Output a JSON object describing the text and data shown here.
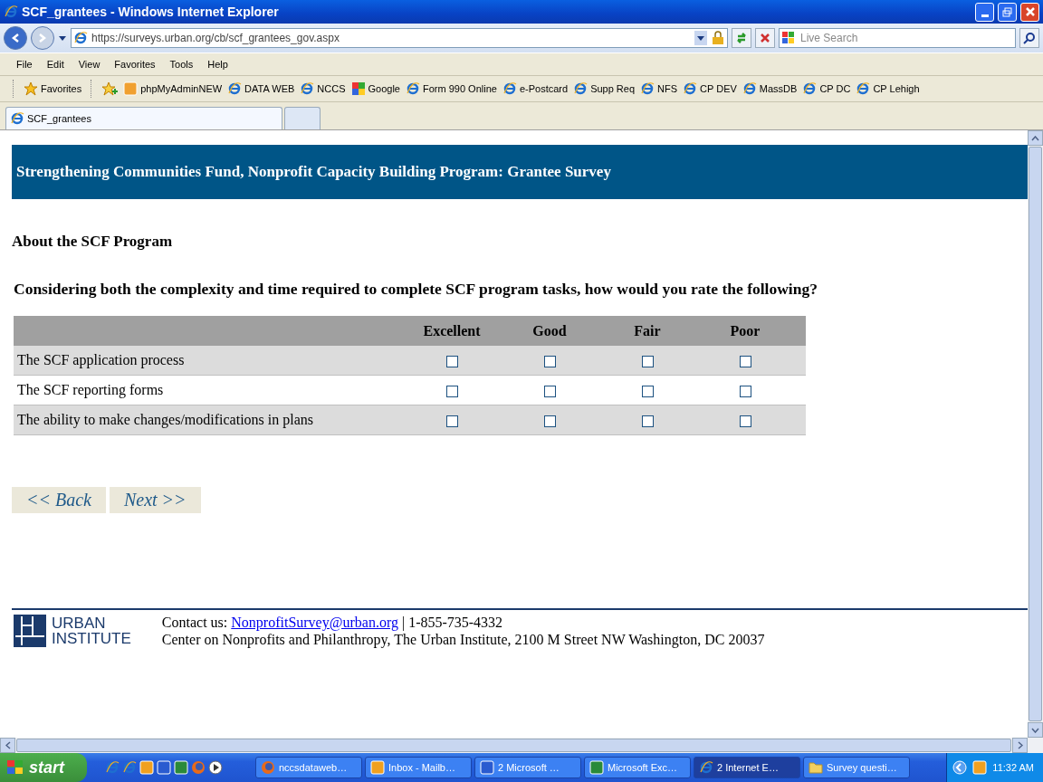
{
  "window": {
    "title": "SCF_grantees - Windows Internet Explorer"
  },
  "address": {
    "url": "https://surveys.urban.org/cb/scf_grantees_gov.aspx"
  },
  "search": {
    "placeholder": "Live Search"
  },
  "menu": [
    "File",
    "Edit",
    "View",
    "Favorites",
    "Tools",
    "Help"
  ],
  "favorites": {
    "label": "Favorites",
    "links": [
      {
        "label": "phpMyAdminNEW",
        "kind": "pma"
      },
      {
        "label": "DATA WEB",
        "kind": "ie"
      },
      {
        "label": "NCCS",
        "kind": "ie"
      },
      {
        "label": "Google",
        "kind": "google"
      },
      {
        "label": "Form 990 Online",
        "kind": "ie"
      },
      {
        "label": "e-Postcard",
        "kind": "ie"
      },
      {
        "label": "Supp Req",
        "kind": "ie"
      },
      {
        "label": "NFS",
        "kind": "ie"
      },
      {
        "label": "CP DEV",
        "kind": "ie"
      },
      {
        "label": "MassDB",
        "kind": "ie"
      },
      {
        "label": "CP DC",
        "kind": "ie"
      },
      {
        "label": "CP Lehigh",
        "kind": "ie"
      }
    ]
  },
  "tabs": [
    {
      "label": "SCF_grantees",
      "selected": true
    }
  ],
  "page": {
    "banner": "Strengthening Communities Fund, Nonprofit Capacity Building Program: Grantee Survey",
    "section": "About the SCF Program",
    "question": "Considering both the complexity and time required to complete SCF program tasks, how would you rate the following?",
    "columns": [
      "Excellent",
      "Good",
      "Fair",
      "Poor"
    ],
    "rows": [
      {
        "label": "The SCF application process",
        "checked": [
          false,
          false,
          false,
          false
        ]
      },
      {
        "label": "The SCF reporting forms",
        "checked": [
          false,
          false,
          false,
          false
        ]
      },
      {
        "label": "The ability to make changes/modifications in plans",
        "checked": [
          false,
          false,
          false,
          false
        ]
      }
    ],
    "buttons": [
      "<< Back",
      "Next >>"
    ],
    "footer": {
      "logo": [
        "URBAN",
        "INSTITUTE"
      ],
      "contact_label": "Contact us:",
      "email": "NonprofitSurvey@urban.org",
      "phone": "| 1-855-735-4332",
      "address": "Center on Nonprofits and Philanthropy, The Urban Institute, 2100 M Street NW Washington, DC 20037"
    }
  },
  "taskbar": {
    "start": "start",
    "tasks": [
      {
        "label": "nccsdataweb…",
        "kind": "firefox",
        "selected": false
      },
      {
        "label": "Inbox - Mailb…",
        "kind": "outlook",
        "selected": false
      },
      {
        "label": "Microsoft …",
        "count": "2",
        "kind": "word",
        "selected": false
      },
      {
        "label": "Microsoft Exc…",
        "kind": "excel",
        "selected": false
      },
      {
        "label": "Internet E…",
        "count": "2",
        "kind": "ie",
        "selected": true
      },
      {
        "label": "Survey questi…",
        "kind": "folder",
        "selected": false
      }
    ],
    "clock": "11:32 AM"
  }
}
